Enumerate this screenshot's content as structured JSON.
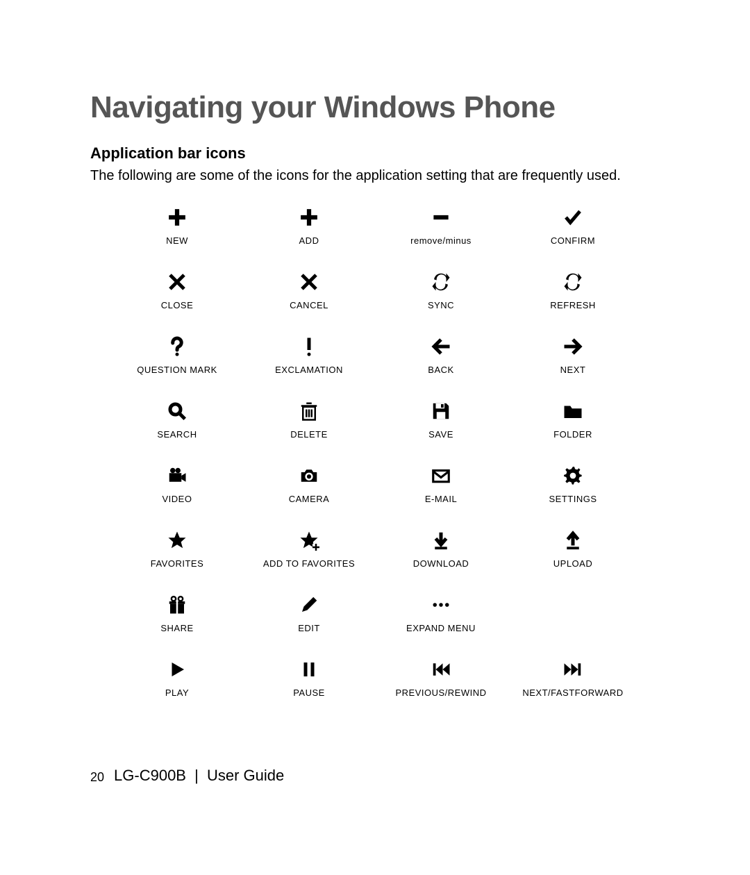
{
  "title": "Navigating your Windows Phone",
  "subtitle": "Application bar icons",
  "intro": "The following are some of the icons for the application setting that are frequently used.",
  "icons": {
    "new": "NEW",
    "add": "ADD",
    "remove": "remove/minus",
    "confirm": "CONFIRM",
    "close": "CLOSE",
    "cancel": "CANCEL",
    "sync": "SYNC",
    "refresh": "REFRESH",
    "question": "QUESTION MARK",
    "exclam": "EXCLAMATION",
    "back": "BACK",
    "next": "NEXT",
    "search": "SEARCH",
    "delete": "DELETE",
    "save": "SAVE",
    "folder": "FOLDER",
    "video": "VIDEO",
    "camera": "CAMERA",
    "email": "E-MAIL",
    "settings": "SETTINGS",
    "favorites": "FAVORITES",
    "addfav": "ADD TO FAVORITES",
    "download": "DOWNLOAD",
    "upload": "UPLOAD",
    "share": "SHARE",
    "edit": "EDIT",
    "expand": "EXPAND MENU",
    "play": "PLAY",
    "pause": "PAUSE",
    "prev": "PREVIOUS/REWIND",
    "nextff": "NEXT/FASTFORWARD"
  },
  "footer": {
    "page": "20",
    "model": "LG-C900B",
    "sep": "|",
    "guide": "User Guide"
  }
}
